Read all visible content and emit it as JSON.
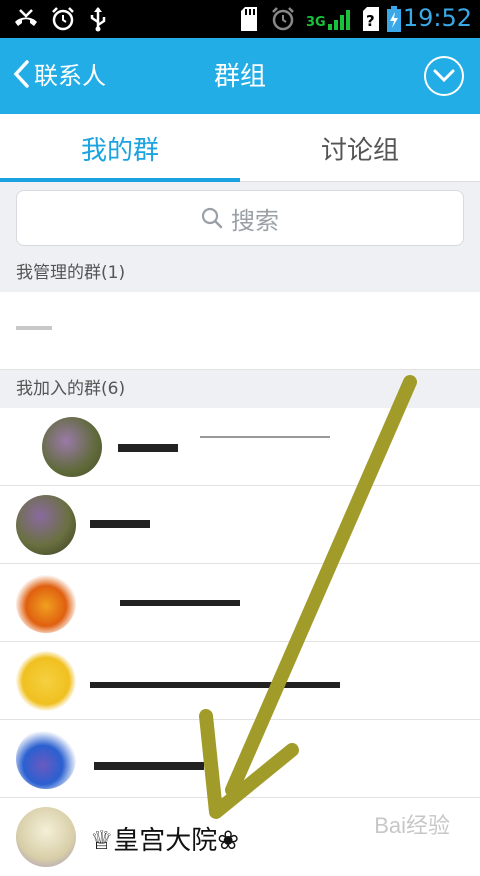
{
  "status_bar": {
    "time": "19:52",
    "network_label": "3G",
    "icons": [
      "missed-call-icon",
      "alarm-icon",
      "usb-icon",
      "sd-card-icon",
      "alarm-icon",
      "signal-icon",
      "unknown-sim-icon",
      "battery-icon"
    ]
  },
  "header": {
    "back_label": "联系人",
    "title": "群组",
    "menu_icon": "chevron-down-circle-icon"
  },
  "tabs": [
    {
      "label": "我的群",
      "active": true
    },
    {
      "label": "讨论组",
      "active": false
    }
  ],
  "search": {
    "placeholder": "搜索"
  },
  "sections": {
    "managed": {
      "label": "我管理的群(1)",
      "groups": [
        {
          "name": ""
        }
      ]
    },
    "joined": {
      "label": "我加入的群(6)",
      "groups": [
        {
          "name": ""
        },
        {
          "name": ""
        },
        {
          "name": ""
        },
        {
          "name": ""
        },
        {
          "name": ""
        },
        {
          "name": "♕皇宫大院❀"
        }
      ]
    }
  },
  "colors": {
    "status_bar": "#000000",
    "header": "#22ade6",
    "accent": "#1aa3e0",
    "section_bg": "#eef0f3",
    "arrow": "#a19b2a"
  },
  "watermark": "Bai经验"
}
